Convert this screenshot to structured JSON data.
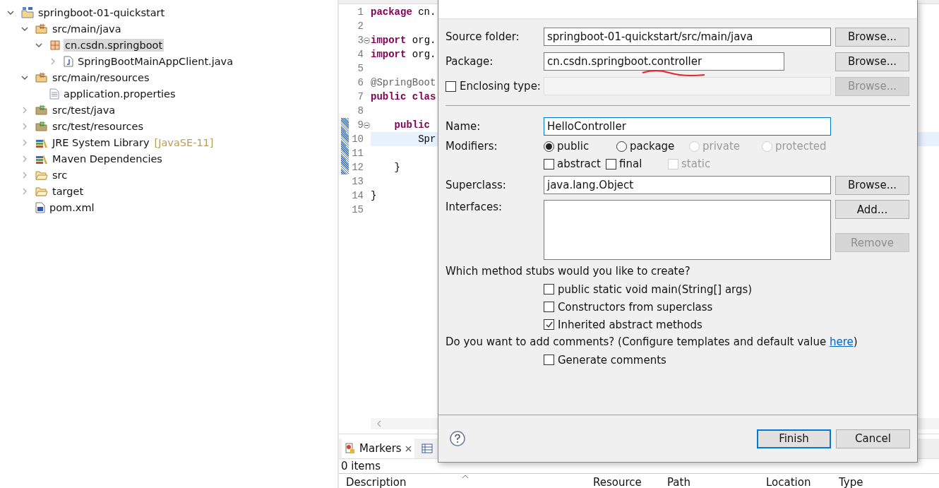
{
  "explorer": {
    "items": [
      {
        "label": "springboot-01-quickstart",
        "kind": "project",
        "expanded": true,
        "selected": false,
        "children": [
          {
            "label": "src/main/java",
            "kind": "source-folder",
            "expanded": true,
            "selected": false,
            "children": [
              {
                "label": "cn.csdn.springboot",
                "kind": "package",
                "expanded": true,
                "selected": true,
                "children": [
                  {
                    "label": "SpringBootMainAppClient.java",
                    "kind": "java-file",
                    "expanded": false,
                    "selected": false
                  }
                ]
              }
            ]
          },
          {
            "label": "src/main/resources",
            "kind": "source-folder",
            "expanded": true,
            "selected": false,
            "children": [
              {
                "label": "application.properties",
                "kind": "file",
                "selected": false
              }
            ]
          },
          {
            "label": "src/test/java",
            "kind": "test-folder",
            "expanded": false,
            "selected": false
          },
          {
            "label": "src/test/resources",
            "kind": "test-folder",
            "expanded": false,
            "selected": false
          },
          {
            "label": "JRE System Library",
            "decoration": "[JavaSE-11]",
            "kind": "library",
            "expanded": false,
            "selected": false
          },
          {
            "label": "Maven Dependencies",
            "kind": "library",
            "expanded": false,
            "selected": false
          },
          {
            "label": "src",
            "kind": "folder",
            "expanded": false,
            "selected": false
          },
          {
            "label": "target",
            "kind": "folder",
            "expanded": false,
            "selected": false
          },
          {
            "label": "pom.xml",
            "kind": "xml",
            "selected": false
          }
        ]
      }
    ]
  },
  "editor": {
    "lines": [
      {
        "number": "1",
        "fold": false,
        "changed": false,
        "current": false,
        "parts": [
          {
            "kind": "keyword",
            "text": "package"
          },
          {
            "kind": "plain",
            "text": " cn."
          }
        ]
      },
      {
        "number": "2",
        "fold": false,
        "changed": false,
        "current": false
      },
      {
        "number": "3",
        "fold": true,
        "changed": false,
        "current": false,
        "parts": [
          {
            "kind": "keyword",
            "text": "import"
          },
          {
            "kind": "plain",
            "text": " org."
          }
        ]
      },
      {
        "number": "4",
        "fold": false,
        "changed": false,
        "current": false,
        "parts": [
          {
            "kind": "keyword",
            "text": "import"
          },
          {
            "kind": "plain",
            "text": " org."
          }
        ]
      },
      {
        "number": "5",
        "fold": false,
        "changed": false,
        "current": false
      },
      {
        "number": "6",
        "fold": false,
        "changed": false,
        "current": false,
        "parts": [
          {
            "kind": "annotation",
            "text": "@SpringBoot"
          }
        ]
      },
      {
        "number": "7",
        "fold": false,
        "changed": false,
        "current": false,
        "parts": [
          {
            "kind": "keyword",
            "text": "public clas"
          }
        ]
      },
      {
        "number": "8",
        "fold": false,
        "changed": false,
        "current": false
      },
      {
        "number": "9",
        "fold": true,
        "changed": true,
        "current": false,
        "parts": [
          {
            "kind": "keyword",
            "text": "    public"
          }
        ]
      },
      {
        "number": "10",
        "fold": false,
        "changed": true,
        "current": true,
        "parts": [
          {
            "kind": "plain",
            "text": "        Spr"
          }
        ]
      },
      {
        "number": "11",
        "fold": false,
        "changed": true,
        "current": false
      },
      {
        "number": "12",
        "fold": false,
        "changed": true,
        "current": false,
        "parts": [
          {
            "kind": "plain",
            "text": "    }"
          }
        ]
      },
      {
        "number": "13",
        "fold": false,
        "changed": false,
        "current": false
      },
      {
        "number": "14",
        "fold": false,
        "changed": false,
        "current": false,
        "parts": [
          {
            "kind": "plain",
            "text": "}"
          }
        ]
      },
      {
        "number": "15",
        "fold": false,
        "changed": false,
        "current": false
      }
    ]
  },
  "markers": {
    "tabs": [
      {
        "label": "Markers",
        "selected": true
      }
    ],
    "count": "0 items",
    "columns": [
      "Description",
      "Resource",
      "Path",
      "Location",
      "Type"
    ]
  },
  "dialog": {
    "source_folder": {
      "label": "Source folder:",
      "value": "springboot-01-quickstart/src/main/java",
      "button": "Browse...",
      "button_disabled": false
    },
    "package": {
      "label": "Package:",
      "value": "cn.csdn.springboot.controller",
      "button": "Browse...",
      "button_disabled": false
    },
    "enclosing_type": {
      "label": "Enclosing type:",
      "checked": false,
      "button": "Browse...",
      "button_disabled": true
    },
    "name": {
      "label": "Name:",
      "value": "HelloController"
    },
    "modifiers": {
      "label": "Modifiers:",
      "options": [
        {
          "label": "public",
          "selected": true,
          "disabled": false
        },
        {
          "label": "package",
          "selected": false,
          "disabled": false
        },
        {
          "label": "private",
          "selected": false,
          "disabled": true
        },
        {
          "label": "protected",
          "selected": false,
          "disabled": true
        }
      ],
      "flags": [
        {
          "label": "abstract",
          "checked": false,
          "disabled": false
        },
        {
          "label": "final",
          "checked": false,
          "disabled": false
        },
        {
          "label": "static",
          "checked": false,
          "disabled": true
        }
      ]
    },
    "superclass": {
      "label": "Superclass:",
      "value": "java.lang.Object",
      "button": "Browse...",
      "button_disabled": false
    },
    "interfaces": {
      "label": "Interfaces:",
      "buttons": [
        {
          "label": "Add...",
          "disabled": false
        },
        {
          "label": "Remove",
          "disabled": true
        }
      ]
    },
    "stubs": {
      "question": "Which method stubs would you like to create?",
      "options": [
        {
          "label": "public static void main(String[] args)",
          "checked": false
        },
        {
          "label": "Constructors from superclass",
          "checked": false
        },
        {
          "label": "Inherited abstract methods",
          "checked": true
        }
      ]
    },
    "comments": {
      "question": "Do you want to add comments? (Configure templates and default value ",
      "link": "here",
      "question_end": ")",
      "options": [
        {
          "label": "Generate comments",
          "checked": false
        }
      ]
    },
    "buttons": [
      {
        "label": "Finish",
        "default": true
      },
      {
        "label": "Cancel",
        "default": false
      }
    ]
  }
}
